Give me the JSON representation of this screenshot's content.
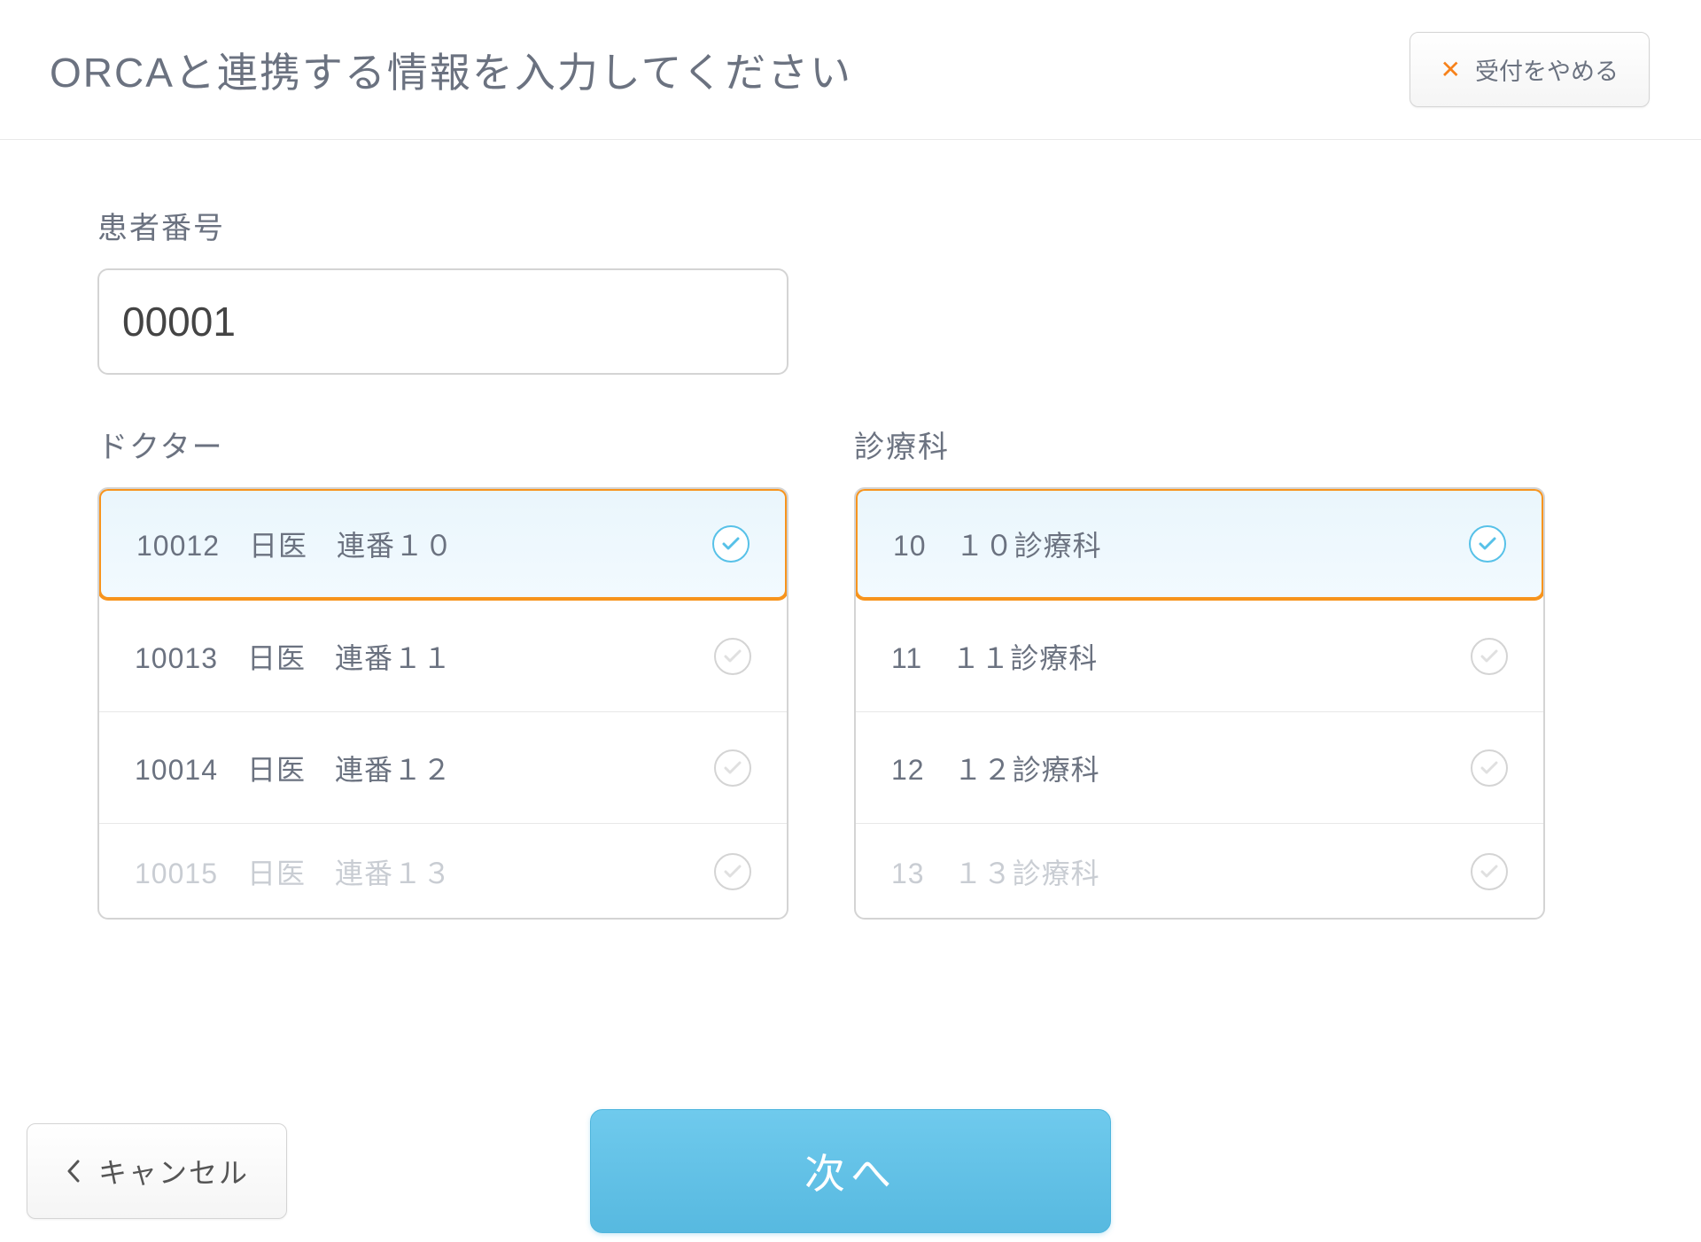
{
  "header": {
    "title": "ORCAと連携する情報を入力してください",
    "stop_label": "受付をやめる"
  },
  "patient": {
    "label": "患者番号",
    "value": "00001"
  },
  "doctor": {
    "label": "ドクター",
    "items": [
      {
        "code": "10012",
        "name": "日医　連番１０",
        "selected": true
      },
      {
        "code": "10013",
        "name": "日医　連番１１",
        "selected": false
      },
      {
        "code": "10014",
        "name": "日医　連番１２",
        "selected": false
      },
      {
        "code": "10015",
        "name": "日医　連番１３",
        "selected": false
      }
    ]
  },
  "department": {
    "label": "診療科",
    "items": [
      {
        "code": "10",
        "name": "１０診療科",
        "selected": true
      },
      {
        "code": "11",
        "name": "１１診療科",
        "selected": false
      },
      {
        "code": "12",
        "name": "１２診療科",
        "selected": false
      },
      {
        "code": "13",
        "name": "１３診療科",
        "selected": false
      }
    ]
  },
  "footer": {
    "cancel_label": "キャンセル",
    "next_label": "次へ"
  }
}
